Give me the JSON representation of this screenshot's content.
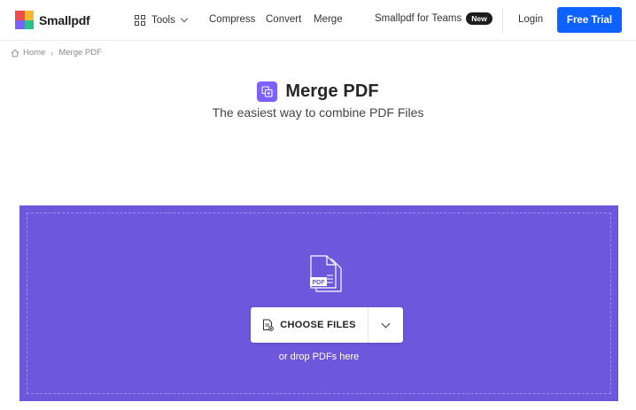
{
  "header": {
    "brand": "Smallpdf",
    "tools_label": "Tools",
    "nav": [
      "Compress",
      "Convert",
      "Merge"
    ],
    "teams_label": "Smallpdf for Teams",
    "teams_badge": "New",
    "login_label": "Login",
    "trial_label": "Free Trial",
    "logo_colors": [
      "#ee4d4d",
      "#f7b731",
      "#7b61ff",
      "#2bbf8c"
    ],
    "trial_color": "#0d62ff"
  },
  "breadcrumb": {
    "home": "Home",
    "separator": "›",
    "current": "Merge PDF"
  },
  "hero": {
    "title": "Merge PDF",
    "subtitle": "The easiest way to combine PDF Files",
    "icon": "merge-icon",
    "accent": "#7b61ff"
  },
  "dropzone": {
    "background": "#6c57dd",
    "illustration_label": "PDF",
    "choose_label": "CHOOSE FILES",
    "hint": "or drop PDFs here"
  }
}
